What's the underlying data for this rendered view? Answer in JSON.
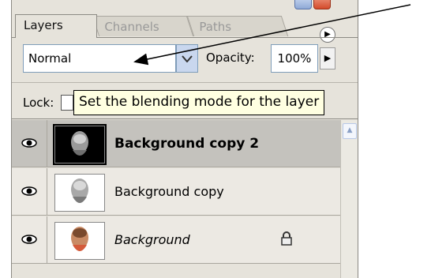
{
  "panel": {
    "tabs": [
      {
        "label": "Layers",
        "active": true
      },
      {
        "label": "Channels",
        "active": false
      },
      {
        "label": "Paths",
        "active": false
      }
    ],
    "blend_mode": "Normal",
    "opacity_label": "Opacity:",
    "opacity_value": "100%",
    "lock_label": "Lock:",
    "tooltip": "Set the blending mode for the layer",
    "layers": [
      {
        "name": "Background copy 2",
        "selected": true,
        "visible": true
      },
      {
        "name": "Background copy",
        "selected": false,
        "visible": true
      },
      {
        "name": "Background",
        "selected": false,
        "visible": true,
        "locked": true
      }
    ]
  },
  "colors": {
    "panel_bg": "#e6e3db",
    "selected_row": "#c4c2bd",
    "tooltip_bg": "#ffffe1"
  }
}
